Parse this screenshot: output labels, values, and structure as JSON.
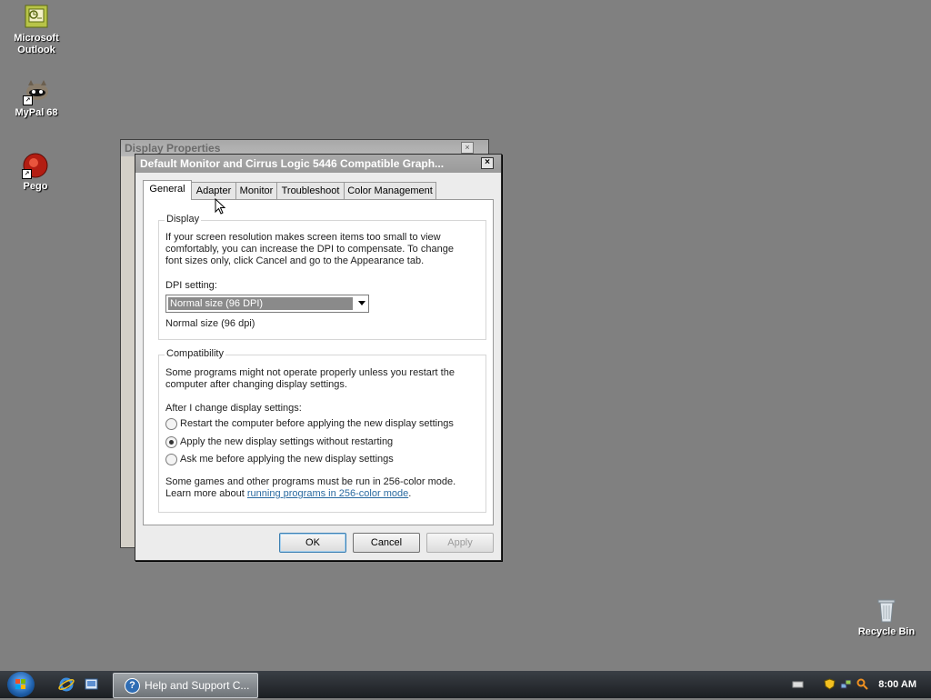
{
  "desktop": {
    "icons": [
      {
        "label_line1": "Microsoft",
        "label_line2": "Outlook"
      },
      {
        "label_line1": "MyPal 68",
        "label_line2": ""
      },
      {
        "label_line1": "Pego",
        "label_line2": ""
      },
      {
        "label_line1": "Recycle Bin",
        "label_line2": ""
      }
    ]
  },
  "background_window": {
    "title": "Display Properties",
    "close": "×"
  },
  "dialog": {
    "title": "Default Monitor and Cirrus Logic 5446 Compatible Graph...",
    "close": "×",
    "tabs": [
      "General",
      "Adapter",
      "Monitor",
      "Troubleshoot",
      "Color Management"
    ],
    "active_tab": "General",
    "display_group": {
      "label": "Display",
      "text1": "If your screen resolution makes screen items too small to view",
      "text2": "comfortably, you can increase the DPI to compensate.  To change",
      "text3": "font sizes only, click Cancel and go to the Appearance tab.",
      "dpi_label": "DPI setting:",
      "dpi_value": "Normal size (96 DPI)",
      "dpi_note": "Normal size (96 dpi)"
    },
    "compat_group": {
      "label": "Compatibility",
      "text1": "Some programs might not operate properly unless you restart the",
      "text2": "computer after changing display settings.",
      "after_label": "After I change display settings:",
      "options": [
        {
          "label": "Restart the computer before applying the new display settings",
          "selected": false
        },
        {
          "label": "Apply the new display settings without restarting",
          "selected": true
        },
        {
          "label": "Ask me before applying the new display settings",
          "selected": false
        }
      ],
      "games1": "Some games and other programs must be run in 256-color mode.",
      "games2_prefix": "Learn more about ",
      "games2_link": "running programs in 256-color mode",
      "games2_suffix": "."
    },
    "buttons": {
      "ok": "OK",
      "cancel": "Cancel",
      "apply": "Apply"
    }
  },
  "taskbar": {
    "task_label": "Help and Support C...",
    "task_icon": "?",
    "clock": "8:00 AM"
  }
}
